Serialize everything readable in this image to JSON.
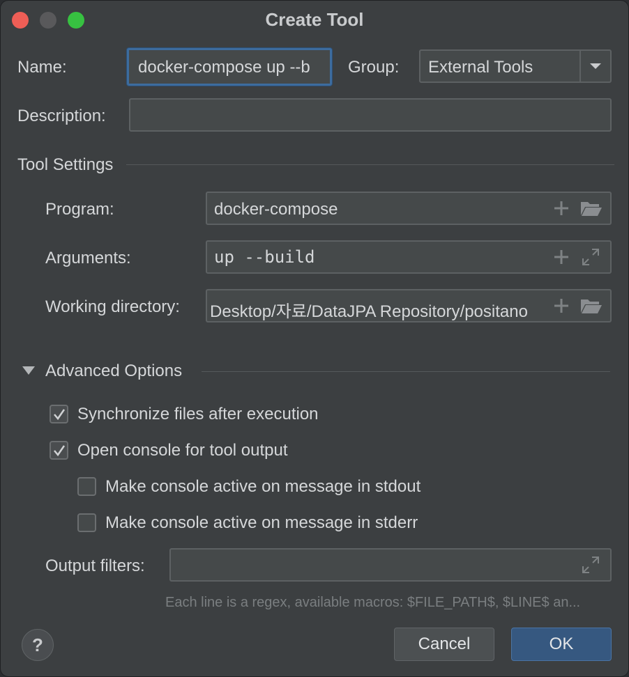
{
  "window": {
    "title": "Create Tool"
  },
  "form": {
    "name_label": "Name:",
    "name_value": "docker-compose up --b",
    "group_label": "Group:",
    "group_value": "External Tools",
    "description_label": "Description:",
    "description_value": ""
  },
  "tool_settings": {
    "section_label": "Tool Settings",
    "program_label": "Program:",
    "program_value": "docker-compose",
    "arguments_label": "Arguments:",
    "arguments_value": "up --build",
    "working_dir_label": "Working directory:",
    "working_dir_value": "Desktop/자료/DataJPA Repository/positano"
  },
  "advanced": {
    "section_label": "Advanced Options",
    "expanded": true,
    "options": [
      {
        "label": "Synchronize files after execution",
        "checked": true
      },
      {
        "label": "Open console for tool output",
        "checked": true
      },
      {
        "label": "Make console active on message in stdout",
        "checked": false
      },
      {
        "label": "Make console active on message in stderr",
        "checked": false
      }
    ],
    "output_filters_label": "Output filters:",
    "output_filters_value": "",
    "hint": "Each line is a regex, available macros: $FILE_PATH$, $LINE$ an..."
  },
  "buttons": {
    "help_label": "?",
    "cancel_label": "Cancel",
    "ok_label": "OK"
  },
  "colors": {
    "window_bg": "#3c3f41",
    "field_bg": "#45494a",
    "focus_border": "#3d6c9e",
    "ok_bg": "#365880",
    "close_button": "#ee5e56",
    "maximize_button": "#37c141"
  },
  "icons": [
    "add-icon",
    "folder-open-icon",
    "expand-icon",
    "chevron-down-icon",
    "check-icon",
    "triangle-down-icon"
  ]
}
